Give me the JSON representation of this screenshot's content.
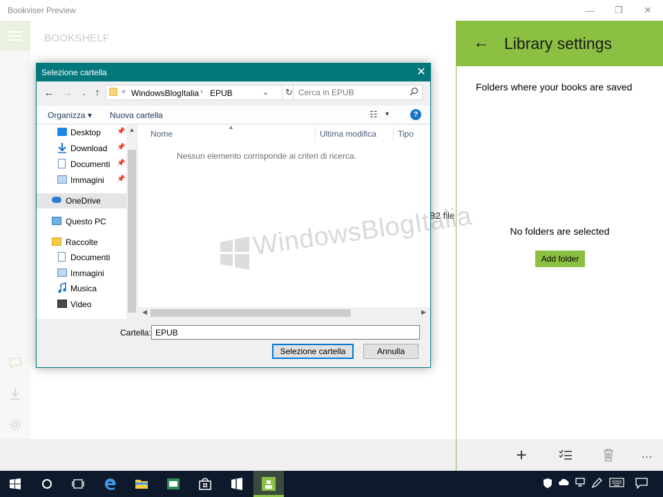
{
  "app": {
    "title": "Bookviser Preview",
    "nav_label": "BOOKSHELF",
    "behind_text": "B2 file",
    "window_controls": {
      "minimize": "—",
      "maximize": "❐",
      "close": "✕"
    },
    "rail_icons": [
      "chat-icon",
      "download-icon",
      "settings-icon"
    ]
  },
  "library": {
    "title": "Library settings",
    "back_glyph": "←",
    "folders_label": "Folders where your books are saved",
    "empty_message": "No folders are selected",
    "add_folder_label": "Add folder",
    "commands": {
      "add": "+",
      "select": "☰",
      "delete": "🗑",
      "more": "..."
    }
  },
  "dialog": {
    "title": "Selezione cartella",
    "close_glyph": "✕",
    "nav": {
      "back": "←",
      "forward": "→",
      "recent": "⌄",
      "up": "↑"
    },
    "address": {
      "prefix": "«",
      "parts": [
        "WindowsBlogItalia",
        "EPUB"
      ],
      "separator": "›",
      "dropdown": "⌄",
      "refresh": "↻"
    },
    "search_placeholder": "Cerca in EPUB",
    "toolbar": {
      "organize": "Organizza ▾",
      "new_folder": "Nuova cartella",
      "view_icon": "☷",
      "view_dd": "▾",
      "help": "?"
    },
    "nav_items": [
      {
        "label": "Desktop",
        "icon": "desktop-icon",
        "pinned": true
      },
      {
        "label": "Download",
        "icon": "download-icon",
        "pinned": true
      },
      {
        "label": "Documenti",
        "icon": "documents-icon",
        "pinned": true
      },
      {
        "label": "Immagini",
        "icon": "pictures-icon",
        "pinned": true
      },
      {
        "label": "OneDrive",
        "icon": "onedrive-icon",
        "pinned": false,
        "selected": true
      },
      {
        "label": "Questo PC",
        "icon": "computer-icon",
        "pinned": false
      },
      {
        "label": "Raccolte",
        "icon": "libraries-icon",
        "pinned": false
      },
      {
        "label": "Documenti",
        "icon": "documents-icon",
        "pinned": false
      },
      {
        "label": "Immagini",
        "icon": "pictures-icon",
        "pinned": false
      },
      {
        "label": "Musica",
        "icon": "music-icon",
        "pinned": false
      },
      {
        "label": "Video",
        "icon": "video-icon",
        "pinned": false
      }
    ],
    "columns": [
      "Nome",
      "Ultima modifica",
      "Tipo"
    ],
    "empty_message": "Nessun elemento corrisponde ai criteri di ricerca.",
    "folder_label": "Cartella:",
    "folder_value": "EPUB",
    "select_button": "Selezione cartella",
    "cancel_button": "Annulla"
  },
  "watermark": "WindowsBlogItalia",
  "colors": {
    "accent_green": "#8cc043",
    "dialog_teal": "#03787c",
    "taskbar": "#0e1a2b"
  }
}
